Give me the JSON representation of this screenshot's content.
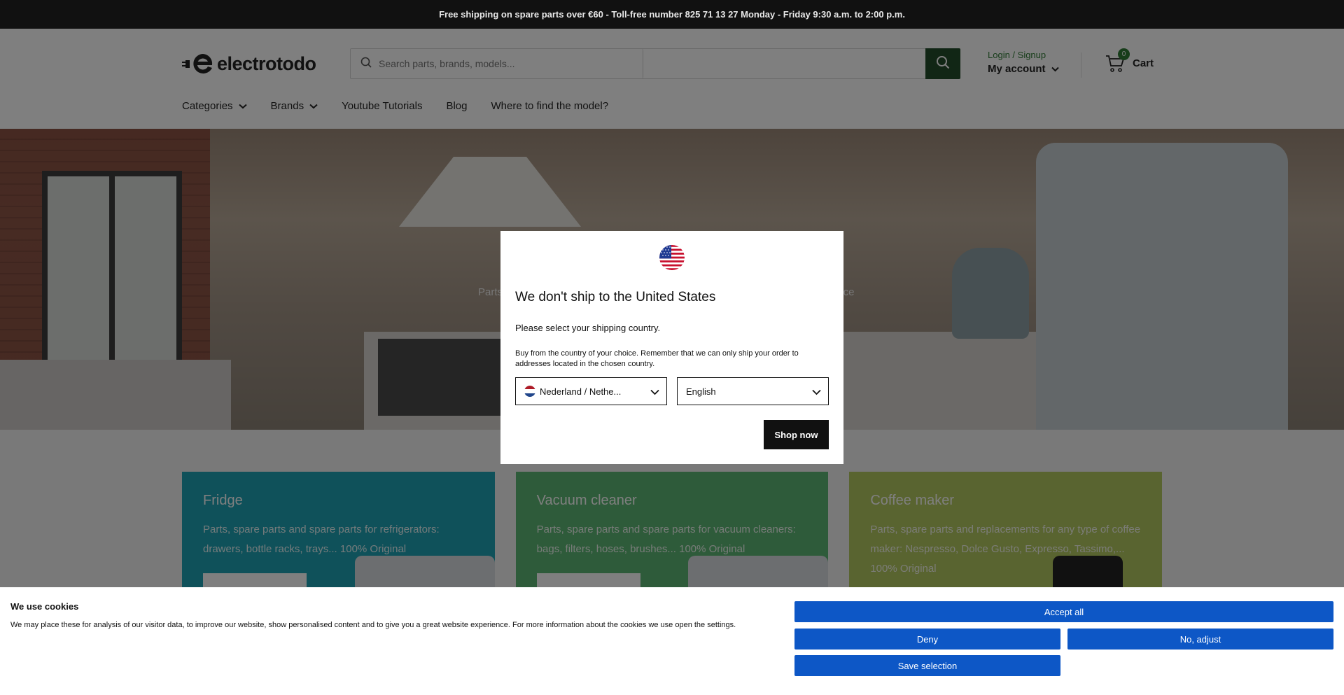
{
  "announcement": "Free shipping on spare parts over €60 - Toll-free number 825 71 13 27 Monday - Friday 9:30 a.m. to 2:00 p.m.",
  "header": {
    "logo_text": "electrotodo",
    "search_placeholder": "Search parts, brands, models...",
    "login_label": "Login / Signup",
    "account_label": "My account",
    "cart_count": "0",
    "cart_label": "Cart"
  },
  "nav": {
    "items": [
      "Categories",
      "Brands",
      "Youtube Tutorials",
      "Blog",
      "Where to find the model?"
    ]
  },
  "hero": {
    "tag_left": "Parts",
    "tag_right": "price"
  },
  "cards": [
    {
      "title": "Fridge",
      "text": "Parts, spare parts and spare parts for refrigerators: drawers, bottle racks, trays... 100% Original",
      "color": "#1fa3b5"
    },
    {
      "title": "Vacuum cleaner",
      "text": "Parts, spare parts and spare parts for vacuum cleaners: bags, filters, hoses, brushes... 100% Original",
      "color": "#5db774"
    },
    {
      "title": "Coffee maker",
      "text": "Parts, spare parts and replacements for any type of coffee maker: Nespresso, Dolce Gusto, Expresso, Tassimo,... 100% Original",
      "color": "#b3c860"
    }
  ],
  "modal": {
    "title": "We don't ship to the United States",
    "subtitle": "Please select your shipping country.",
    "description": "Buy from the country of your choice. Remember that we can only ship your order to addresses located in the chosen country.",
    "country_selected": "Nederland / Nethe...",
    "language_selected": "English",
    "shop_button": "Shop now"
  },
  "cookie": {
    "title": "We use cookies",
    "text": "We may place these for analysis of our visitor data, to improve our website, show personalised content and to give you a great website experience. For more information about the cookies we use open the settings.",
    "accept_all": "Accept all",
    "deny": "Deny",
    "adjust": "No, adjust",
    "save": "Save selection"
  },
  "colors": {
    "brand_green": "#234d2a",
    "link_green": "#2f7a34",
    "cookie_blue": "#0d57c6"
  }
}
